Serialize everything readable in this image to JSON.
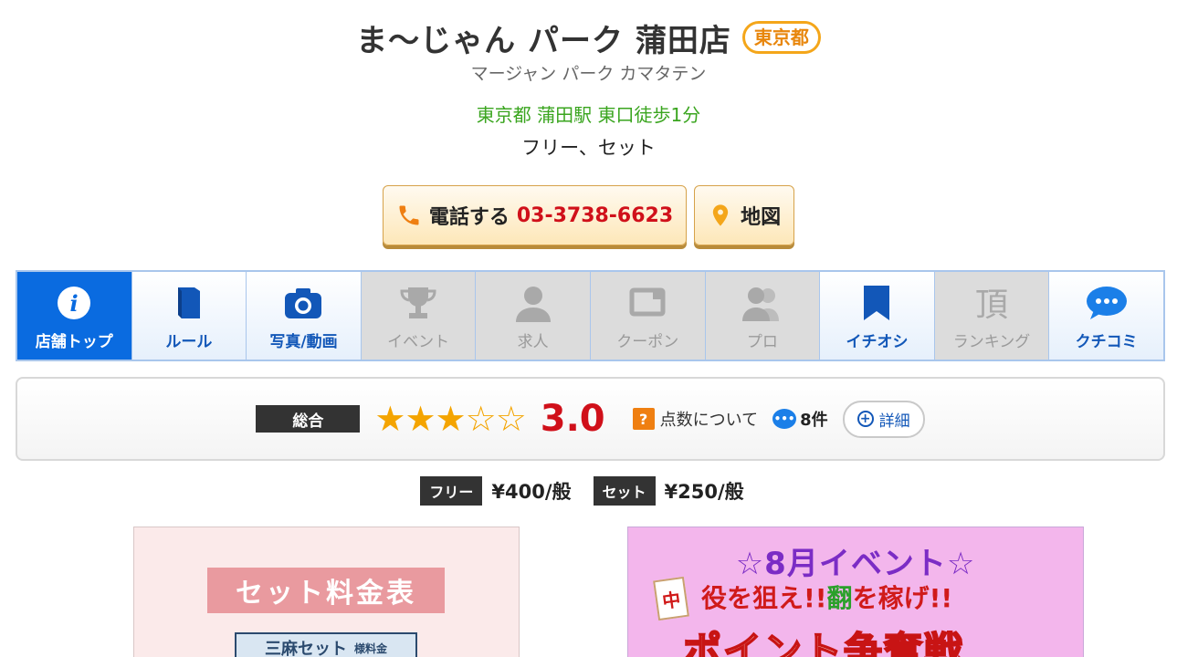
{
  "shop": {
    "name": "ま〜じゃん パーク 蒲田店",
    "prefecture_badge": "東京都",
    "kana": "マージャン パーク カマタテン",
    "access": "東京都 蒲田駅 東口徒歩1分",
    "types": "フリー、セット"
  },
  "actions": {
    "call_label": "電話する",
    "phone": "03-3738-6623",
    "map_label": "地図"
  },
  "nav": {
    "items": [
      {
        "label": "店舗トップ",
        "icon": "info-icon",
        "state": "active"
      },
      {
        "label": "ルール",
        "icon": "book-icon",
        "state": "enabled"
      },
      {
        "label": "写真/動画",
        "icon": "camera-icon",
        "state": "enabled"
      },
      {
        "label": "イベント",
        "icon": "trophy-icon",
        "state": "disabled"
      },
      {
        "label": "求人",
        "icon": "person-icon",
        "state": "disabled"
      },
      {
        "label": "クーポン",
        "icon": "ticket-icon",
        "state": "disabled"
      },
      {
        "label": "プロ",
        "icon": "group-icon",
        "state": "disabled"
      },
      {
        "label": "イチオシ",
        "icon": "bookmark-icon",
        "state": "enabled"
      },
      {
        "label": "ランキング",
        "icon": "rank-kanji-icon",
        "state": "disabled"
      },
      {
        "label": "クチコミ",
        "icon": "chat-bubble-icon",
        "state": "enabled"
      }
    ]
  },
  "rating": {
    "label": "総合",
    "stars_filled": 3,
    "stars_total": 5,
    "score": "3.0",
    "help_mark": "?",
    "about_label": "点数について",
    "review_count": "8件",
    "detail_label": "詳細"
  },
  "prices": [
    {
      "tag": "フリー",
      "value": "¥400/般"
    },
    {
      "tag": "セット",
      "value": "¥250/般"
    }
  ],
  "banners": {
    "left": {
      "title": "セット料金表",
      "sub": "三麻セット",
      "sub_small": "様料金"
    },
    "right": {
      "title": "☆8月イベント☆",
      "line2a": "役を狙え!!",
      "line2b": "翻",
      "line2c": "を稼げ!!",
      "line3": "ポイント争奪戦",
      "tile": "中"
    }
  },
  "colors": {
    "accent_blue": "#0a6be0",
    "price_red": "#d0101a",
    "access_green": "#3aa51f",
    "badge_orange": "#f4a61a",
    "star_gold": "#f4a400"
  }
}
